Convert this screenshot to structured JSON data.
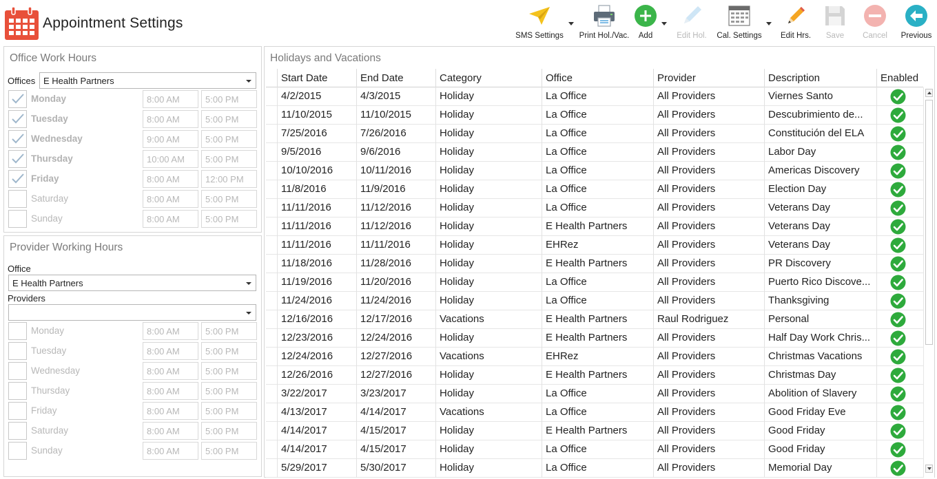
{
  "app": {
    "title": "Appointment Settings"
  },
  "toolbar": {
    "sms": "SMS Settings",
    "print": "Print Hol./Vac.",
    "add": "Add",
    "edit_hol": "Edit Hol.",
    "cal": "Cal. Settings",
    "edit_hrs": "Edit Hrs.",
    "save": "Save",
    "cancel": "Cancel",
    "previous": "Previous"
  },
  "office_hours": {
    "title": "Office Work Hours",
    "offices_label": "Offices",
    "office_value": "E Health Partners",
    "days": [
      {
        "name": "Monday",
        "checked": true,
        "start": "8:00 AM",
        "end": "5:00 PM"
      },
      {
        "name": "Tuesday",
        "checked": true,
        "start": "8:00 AM",
        "end": "5:00 PM"
      },
      {
        "name": "Wednesday",
        "checked": true,
        "start": "9:00 AM",
        "end": "5:00 PM"
      },
      {
        "name": "Thursday",
        "checked": true,
        "start": "10:00 AM",
        "end": "5:00 PM"
      },
      {
        "name": "Friday",
        "checked": true,
        "start": "8:00 AM",
        "end": "12:00 PM"
      },
      {
        "name": "Saturday",
        "checked": false,
        "start": "8:00 AM",
        "end": "5:00 PM"
      },
      {
        "name": "Sunday",
        "checked": false,
        "start": "8:00 AM",
        "end": "5:00 PM"
      }
    ]
  },
  "provider_hours": {
    "title": "Provider Working Hours",
    "office_label": "Office",
    "office_value": "E Health Partners",
    "providers_label": "Providers",
    "providers_value": "",
    "days": [
      {
        "name": "Monday",
        "checked": false,
        "start": "8:00 AM",
        "end": "5:00 PM"
      },
      {
        "name": "Tuesday",
        "checked": false,
        "start": "8:00 AM",
        "end": "5:00 PM"
      },
      {
        "name": "Wednesday",
        "checked": false,
        "start": "8:00 AM",
        "end": "5:00 PM"
      },
      {
        "name": "Thursday",
        "checked": false,
        "start": "8:00 AM",
        "end": "5:00 PM"
      },
      {
        "name": "Friday",
        "checked": false,
        "start": "8:00 AM",
        "end": "5:00 PM"
      },
      {
        "name": "Saturday",
        "checked": false,
        "start": "8:00 AM",
        "end": "5:00 PM"
      },
      {
        "name": "Sunday",
        "checked": false,
        "start": "8:00 AM",
        "end": "5:00 PM"
      }
    ]
  },
  "holidays": {
    "title": "Holidays and Vacations",
    "columns": [
      "Start Date",
      "End Date",
      "Category",
      "Office",
      "Provider",
      "Description",
      "Enabled"
    ],
    "rows": [
      [
        "4/2/2015",
        "4/3/2015",
        "Holiday",
        "La Office",
        "All Providers",
        "Viernes Santo",
        true
      ],
      [
        "11/10/2015",
        "11/10/2015",
        "Holiday",
        "La Office",
        "All Providers",
        "Descubrimiento de...",
        true
      ],
      [
        "7/25/2016",
        "7/26/2016",
        "Holiday",
        "La Office",
        "All Providers",
        "Constitución del ELA",
        true
      ],
      [
        "9/5/2016",
        "9/6/2016",
        "Holiday",
        "La Office",
        "All Providers",
        "Labor Day",
        true
      ],
      [
        "10/10/2016",
        "10/11/2016",
        "Holiday",
        "La Office",
        "All Providers",
        "Americas Discovery",
        true
      ],
      [
        "11/8/2016",
        "11/9/2016",
        "Holiday",
        "La Office",
        "All Providers",
        "Election Day",
        true
      ],
      [
        "11/11/2016",
        "11/12/2016",
        "Holiday",
        "La Office",
        "All Providers",
        "Veterans Day",
        true
      ],
      [
        "11/11/2016",
        "11/12/2016",
        "Holiday",
        "E Health Partners",
        "All Providers",
        "Veterans Day",
        true
      ],
      [
        "11/11/2016",
        "11/11/2016",
        "Holiday",
        "EHRez",
        "All Providers",
        "Veterans Day",
        true
      ],
      [
        "11/18/2016",
        "11/28/2016",
        "Holiday",
        "E Health Partners",
        "All Providers",
        "PR Discovery",
        true
      ],
      [
        "11/19/2016",
        "11/20/2016",
        "Holiday",
        "La Office",
        "All Providers",
        "Puerto Rico Discove...",
        true
      ],
      [
        "11/24/2016",
        "11/24/2016",
        "Holiday",
        "La Office",
        "All Providers",
        "Thanksgiving",
        true
      ],
      [
        "12/16/2016",
        "12/17/2016",
        "Vacations",
        "E Health Partners",
        "Raul Rodriguez",
        "Personal",
        true
      ],
      [
        "12/23/2016",
        "12/24/2016",
        "Holiday",
        "E Health Partners",
        "All Providers",
        "Half Day Work Chris...",
        true
      ],
      [
        "12/24/2016",
        "12/27/2016",
        "Vacations",
        "EHRez",
        "All Providers",
        "Christmas Vacations",
        true
      ],
      [
        "12/26/2016",
        "12/27/2016",
        "Holiday",
        "E Health Partners",
        "All Providers",
        "Christmas Day",
        true
      ],
      [
        "3/22/2017",
        "3/23/2017",
        "Holiday",
        "La Office",
        "All Providers",
        "Abolition of Slavery",
        true
      ],
      [
        "4/13/2017",
        "4/14/2017",
        "Vacations",
        "La Office",
        "All Providers",
        "Good Friday Eve",
        true
      ],
      [
        "4/14/2017",
        "4/15/2017",
        "Holiday",
        "E Health Partners",
        "All Providers",
        "Good Friday",
        true
      ],
      [
        "4/14/2017",
        "4/15/2017",
        "Holiday",
        "La Office",
        "All Providers",
        "Good Friday",
        true
      ],
      [
        "5/29/2017",
        "5/30/2017",
        "Holiday",
        "La Office",
        "All Providers",
        "Memorial Day",
        true
      ]
    ]
  },
  "colors": {
    "accent_orange": "#e8503a",
    "enabled_green": "#2eaa3c",
    "add_green": "#3bb54a",
    "previous_teal": "#2ab0c5",
    "disabled_gray": "#b9b9b9"
  }
}
